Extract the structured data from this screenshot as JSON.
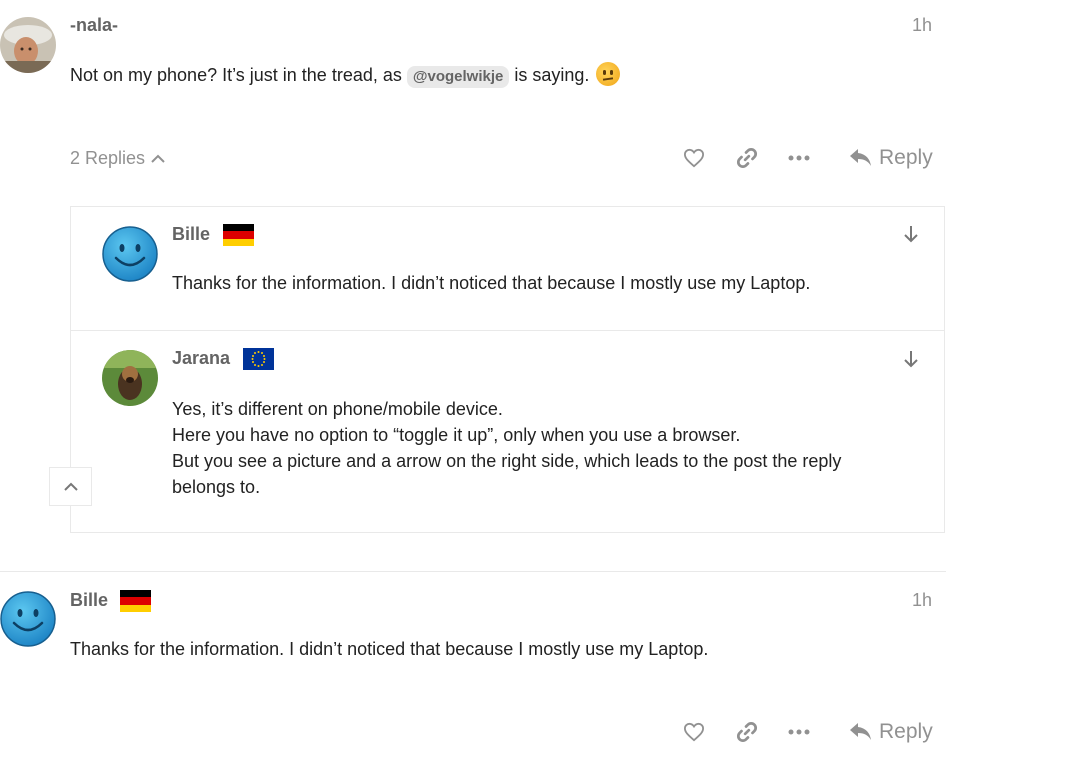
{
  "post1": {
    "username": "-nala-",
    "date": "1h",
    "text_before": "Not on my phone? It’s just in the tread, as",
    "mention": "@vogelwikje",
    "text_after": "is saying.",
    "emoji": "thinking-face-icon",
    "replies_toggle": "2 Replies",
    "reply_label": "Reply"
  },
  "embedded_replies": [
    {
      "username": "Bille",
      "flag": "germany-flag",
      "text": "Thanks for the information. I didn’t noticed that because I mostly use my Laptop."
    },
    {
      "username": "Jarana",
      "flag": "eu-flag",
      "lines": [
        "Yes, it’s different on phone/mobile device.",
        "Here you have no option to “toggle it up”, only when you use a browser.",
        "But you see a picture and a arrow on the right side, which leads to the post the reply",
        "belongs to."
      ]
    }
  ],
  "post2": {
    "username": "Bille",
    "flag": "germany-flag",
    "date": "1h",
    "text": "Thanks for the information. I didn’t noticed that because I mostly use my Laptop.",
    "reply_label": "Reply"
  },
  "colors": {
    "muted": "#919191",
    "username": "#646464",
    "border": "#e9e9e9"
  }
}
